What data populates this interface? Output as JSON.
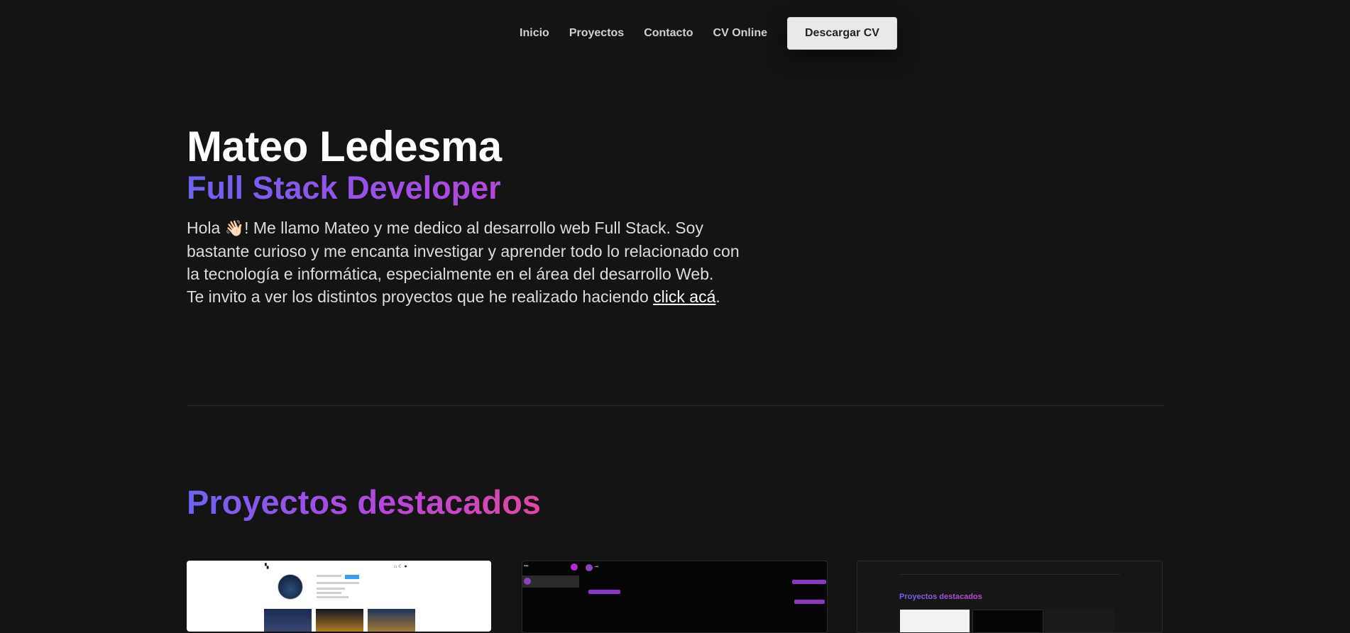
{
  "nav": {
    "items": [
      "Inicio",
      "Proyectos",
      "Contacto",
      "CV Online"
    ],
    "download_label": "Descargar CV"
  },
  "hero": {
    "name": "Mateo Ledesma",
    "role": "Full Stack Developer",
    "greeting": "Hola ",
    "wave_emoji": "👋🏻",
    "intro": "! Me llamo Mateo y me dedico al desarrollo web Full Stack. Soy bastante curioso y me encanta investigar y aprender todo lo relacionado con la tecnología e informática, especialmente en el área del desarrollo Web.",
    "invite": "Te invito a ver los distintos proyectos que he realizado haciendo ",
    "link_text": "click acá",
    "invite_end": "."
  },
  "projects": {
    "title": "Proyectos destacados",
    "cards": [
      {
        "preview": "instagram-clone"
      },
      {
        "preview": "chat-app"
      },
      {
        "preview": "portfolio",
        "inner_title": "Proyectos destacados"
      }
    ]
  },
  "colors": {
    "background": "#141414",
    "gradient_start": "#6d63f0",
    "gradient_mid": "#b447de",
    "gradient_end": "#e0479f",
    "button_bg": "#e9e9e9"
  }
}
